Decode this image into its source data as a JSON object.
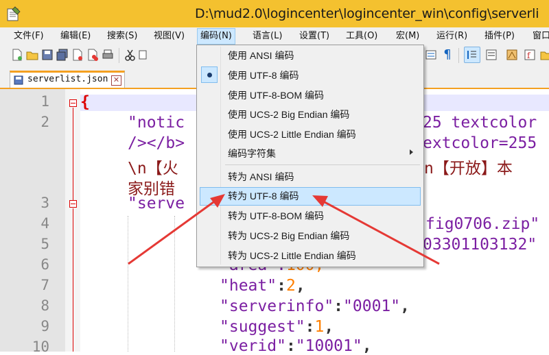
{
  "window": {
    "title": "D:\\mud2.0\\logincenter\\logincenter_win\\config\\serverli"
  },
  "menubar": {
    "items": [
      {
        "label": "文件(F)"
      },
      {
        "label": "编辑(E)"
      },
      {
        "label": "搜索(S)"
      },
      {
        "label": "视图(V)"
      },
      {
        "label": "编码(N)",
        "active": true
      },
      {
        "label": "语言(L)"
      },
      {
        "label": "设置(T)"
      },
      {
        "label": "工具(O)"
      },
      {
        "label": "宏(M)"
      },
      {
        "label": "运行(R)"
      },
      {
        "label": "插件(P)"
      },
      {
        "label": "窗口"
      }
    ]
  },
  "tab": {
    "label": "serverlist.json",
    "close": "✕"
  },
  "editor": {
    "line_numbers": [
      "1",
      "2",
      "",
      "",
      "",
      "3",
      "4",
      "5",
      "6",
      "7",
      "8",
      "9",
      "10"
    ],
    "lines": {
      "l1": "{",
      "l2a": "\"notic",
      "l2b": "25 textcolor",
      "l2c": "/></b>",
      "l2d": "extcolor=255",
      "l2e": "\\n【火",
      "l2f": "n【开放】本",
      "l2g": "家别错",
      "l3": "\"serve",
      "l4": "fig0706.zip\"",
      "l5": "03301103132\"",
      "l6a": "\"area\":",
      "l6b": "100,",
      "l7a": "\"heat\"",
      "l7b": ":",
      "l7c": "2",
      "l7d": ",",
      "l8a": "\"serverinfo\"",
      "l8b": ":",
      "l8c": "\"0001\"",
      "l8d": ",",
      "l9a": "\"suggest\"",
      "l9b": ":",
      "l9c": "1",
      "l9d": ",",
      "l10a": "\"verid\"",
      "l10b": ":",
      "l10c": "\"10001\"",
      "l10d": ","
    }
  },
  "encoding_menu": {
    "items": [
      {
        "label": "使用 ANSI 编码"
      },
      {
        "label": "使用 UTF-8 编码",
        "checked": true
      },
      {
        "label": "使用 UTF-8-BOM 编码"
      },
      {
        "label": "使用 UCS-2 Big Endian 编码"
      },
      {
        "label": "使用 UCS-2 Little Endian 编码"
      },
      {
        "label": "编码字符集",
        "submenu": true
      },
      {
        "label": "转为 ANSI 编码"
      },
      {
        "label": "转为 UTF-8 编码",
        "highlighted": true
      },
      {
        "label": "转为 UTF-8-BOM 编码"
      },
      {
        "label": "转为 UCS-2 Big Endian 编码"
      },
      {
        "label": "转为 UCS-2 Little Endian 编码"
      }
    ]
  },
  "toolbar": {
    "icons": [
      "new-file-icon",
      "open-file-icon",
      "save-icon",
      "save-all-icon",
      "close-icon",
      "close-all-icon",
      "print-icon",
      "cut-icon",
      "copy-icon",
      "show-all-chars-icon",
      "indent-guide-icon",
      "word-wrap-icon",
      "doc-map-icon",
      "function-list-icon",
      "folder-workspace-icon"
    ]
  },
  "colors": {
    "titlebar": "#f4c12f",
    "tab_accent": "#f4a020",
    "keyword": "#7b1fa2",
    "number": "#ff7f00",
    "annotation_arrow": "#e53935"
  }
}
